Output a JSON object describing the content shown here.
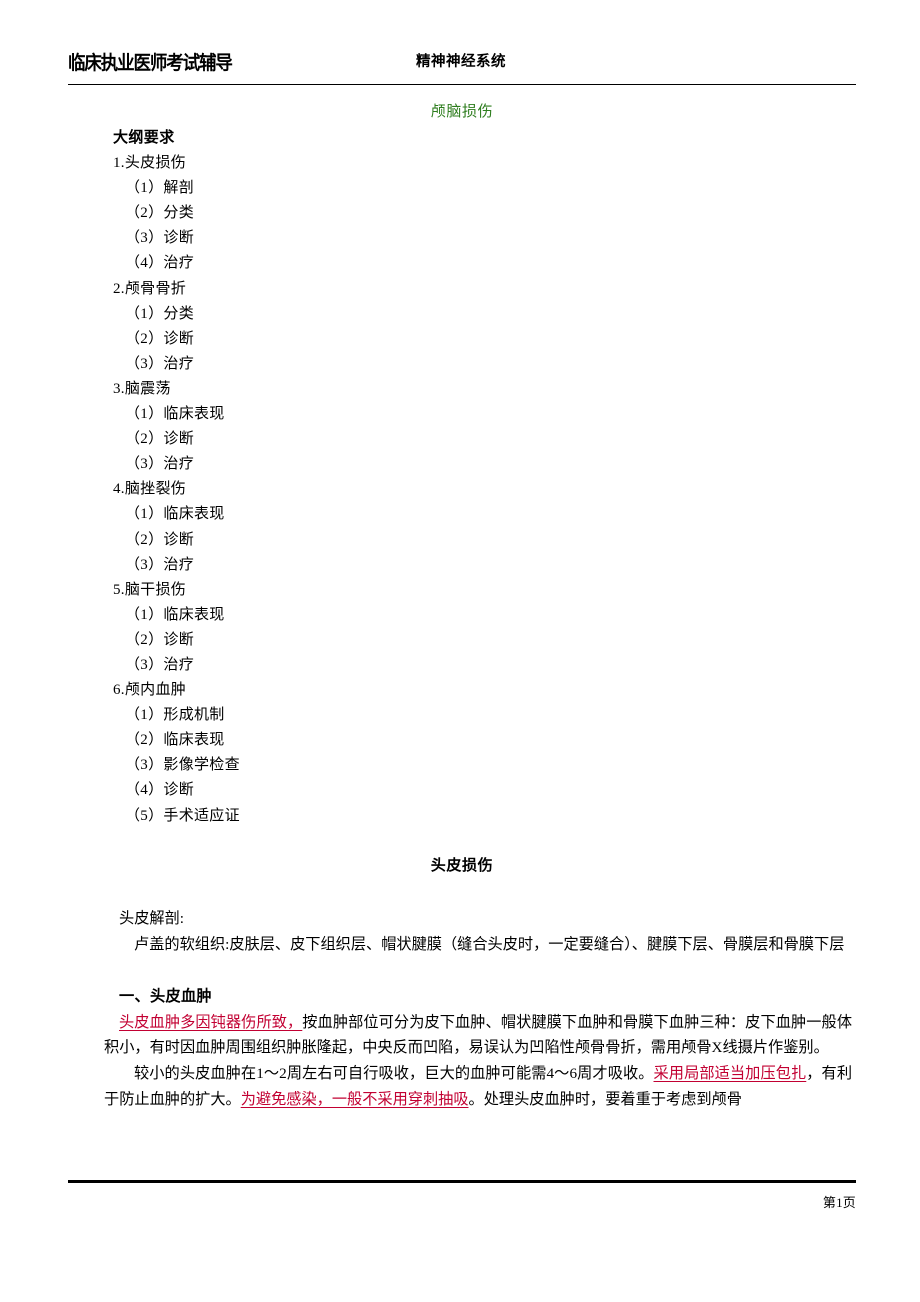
{
  "header": {
    "left_title": "临床执业医师考试辅导",
    "center_title": "精神神经系统"
  },
  "document": {
    "title": "颅脑损伤",
    "title_color": "#2e7d1e"
  },
  "outline": {
    "heading": "大纲要求",
    "items": [
      {
        "level": 1,
        "text": "1.头皮损伤"
      },
      {
        "level": 2,
        "text": "（1）解剖"
      },
      {
        "level": 2,
        "text": "（2）分类"
      },
      {
        "level": 2,
        "text": "（3）诊断"
      },
      {
        "level": 2,
        "text": "（4）治疗"
      },
      {
        "level": 1,
        "text": "2.颅骨骨折"
      },
      {
        "level": 2,
        "text": "（1）分类"
      },
      {
        "level": 2,
        "text": "（2）诊断"
      },
      {
        "level": 2,
        "text": "（3）治疗"
      },
      {
        "level": 1,
        "text": "3.脑震荡"
      },
      {
        "level": 2,
        "text": "（1）临床表现"
      },
      {
        "level": 2,
        "text": "（2）诊断"
      },
      {
        "level": 2,
        "text": "（3）治疗"
      },
      {
        "level": 1,
        "text": "4.脑挫裂伤"
      },
      {
        "level": 2,
        "text": "（1）临床表现"
      },
      {
        "level": 2,
        "text": "（2）诊断"
      },
      {
        "level": 2,
        "text": "（3）治疗"
      },
      {
        "level": 1,
        "text": "5.脑干损伤"
      },
      {
        "level": 2,
        "text": "（1）临床表现"
      },
      {
        "level": 2,
        "text": "（2）诊断"
      },
      {
        "level": 2,
        "text": "（3）治疗"
      },
      {
        "level": 1,
        "text": "6.颅内血肿"
      },
      {
        "level": 2,
        "text": "（1）形成机制"
      },
      {
        "level": 2,
        "text": "（2）临床表现"
      },
      {
        "level": 2,
        "text": "（3）影像学检查"
      },
      {
        "level": 2,
        "text": "（4）诊断"
      },
      {
        "level": 2,
        "text": "（5）手术适应证"
      }
    ]
  },
  "section": {
    "heading": "头皮损伤",
    "anatomy_label": "头皮解剖:",
    "anatomy_text": "卢盖的软组织:皮肤层、皮下组织层、帽状腱膜（缝合头皮时，一定要缝合）、腱膜下层、骨膜层和骨膜下层",
    "subheading": "一、头皮血肿",
    "para1_highlight": "头皮血肿多因钝器伤所致，",
    "para1_rest": "按血肿部位可分为皮下血肿、帽状腱膜下血肿和骨膜下血肿三种：皮下血肿一般体积小，有时因血肿周围组织肿胀隆起，中央反而凹陷，易误认为凹陷性颅骨骨折，需用颅骨X线摄片作鉴别。",
    "para2_a": "较小的头皮血肿在1～2周左右可自行吸收，巨大的血肿可能需4～6周才吸收。",
    "para2_hl1": "采用局部适当加压包扎",
    "para2_b": "，有利于防止血肿的扩大。",
    "para2_hl2": "为避免感染，一般不采用穿刺抽吸",
    "para2_c": "。处理头皮血肿时，要着重于考虑到颅骨"
  },
  "footer": {
    "page_label": "第1页"
  },
  "colors": {
    "highlight_red": "#c20032",
    "title_green": "#2e7d1e",
    "text_black": "#000000"
  }
}
